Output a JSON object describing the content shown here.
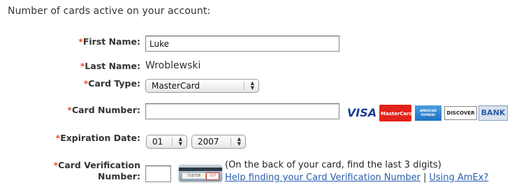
{
  "heading": "Number of cards active on your account:",
  "required_marker": "*",
  "form": {
    "first_name": {
      "label": "First Name:",
      "value": "Luke"
    },
    "last_name": {
      "label": "Last Name:",
      "value": "Wroblewski"
    },
    "card_type": {
      "label": "Card Type:",
      "selected": "MasterCard"
    },
    "card_number": {
      "label": "Card Number:",
      "value": ""
    },
    "expiration": {
      "label": "Expiration Date:",
      "month": "01",
      "year": "2007"
    },
    "cvv": {
      "label_line1": "Card Verification",
      "label_line2": "Number:",
      "value": "",
      "image_sig_text": "710718",
      "image_code_text": "037",
      "note": "(On the back of your card, find the last 3 digits)",
      "help_link": "Help finding your Card Verification Number",
      "amex_link": "Using AmEx?",
      "link_divider": "|"
    }
  },
  "card_logos": [
    {
      "name": "VISA",
      "color": "#1a3f94"
    },
    {
      "name": "MasterCard",
      "color": "#e2231a"
    },
    {
      "name": "AMERICAN EXPRESS",
      "color": "#1f73c4"
    },
    {
      "name": "DISCOVER",
      "color": "#f47b20"
    },
    {
      "name": "BANK",
      "color": "#2a5ea8"
    }
  ],
  "colors": {
    "required": "#e8562a",
    "link": "#2a5db0"
  }
}
